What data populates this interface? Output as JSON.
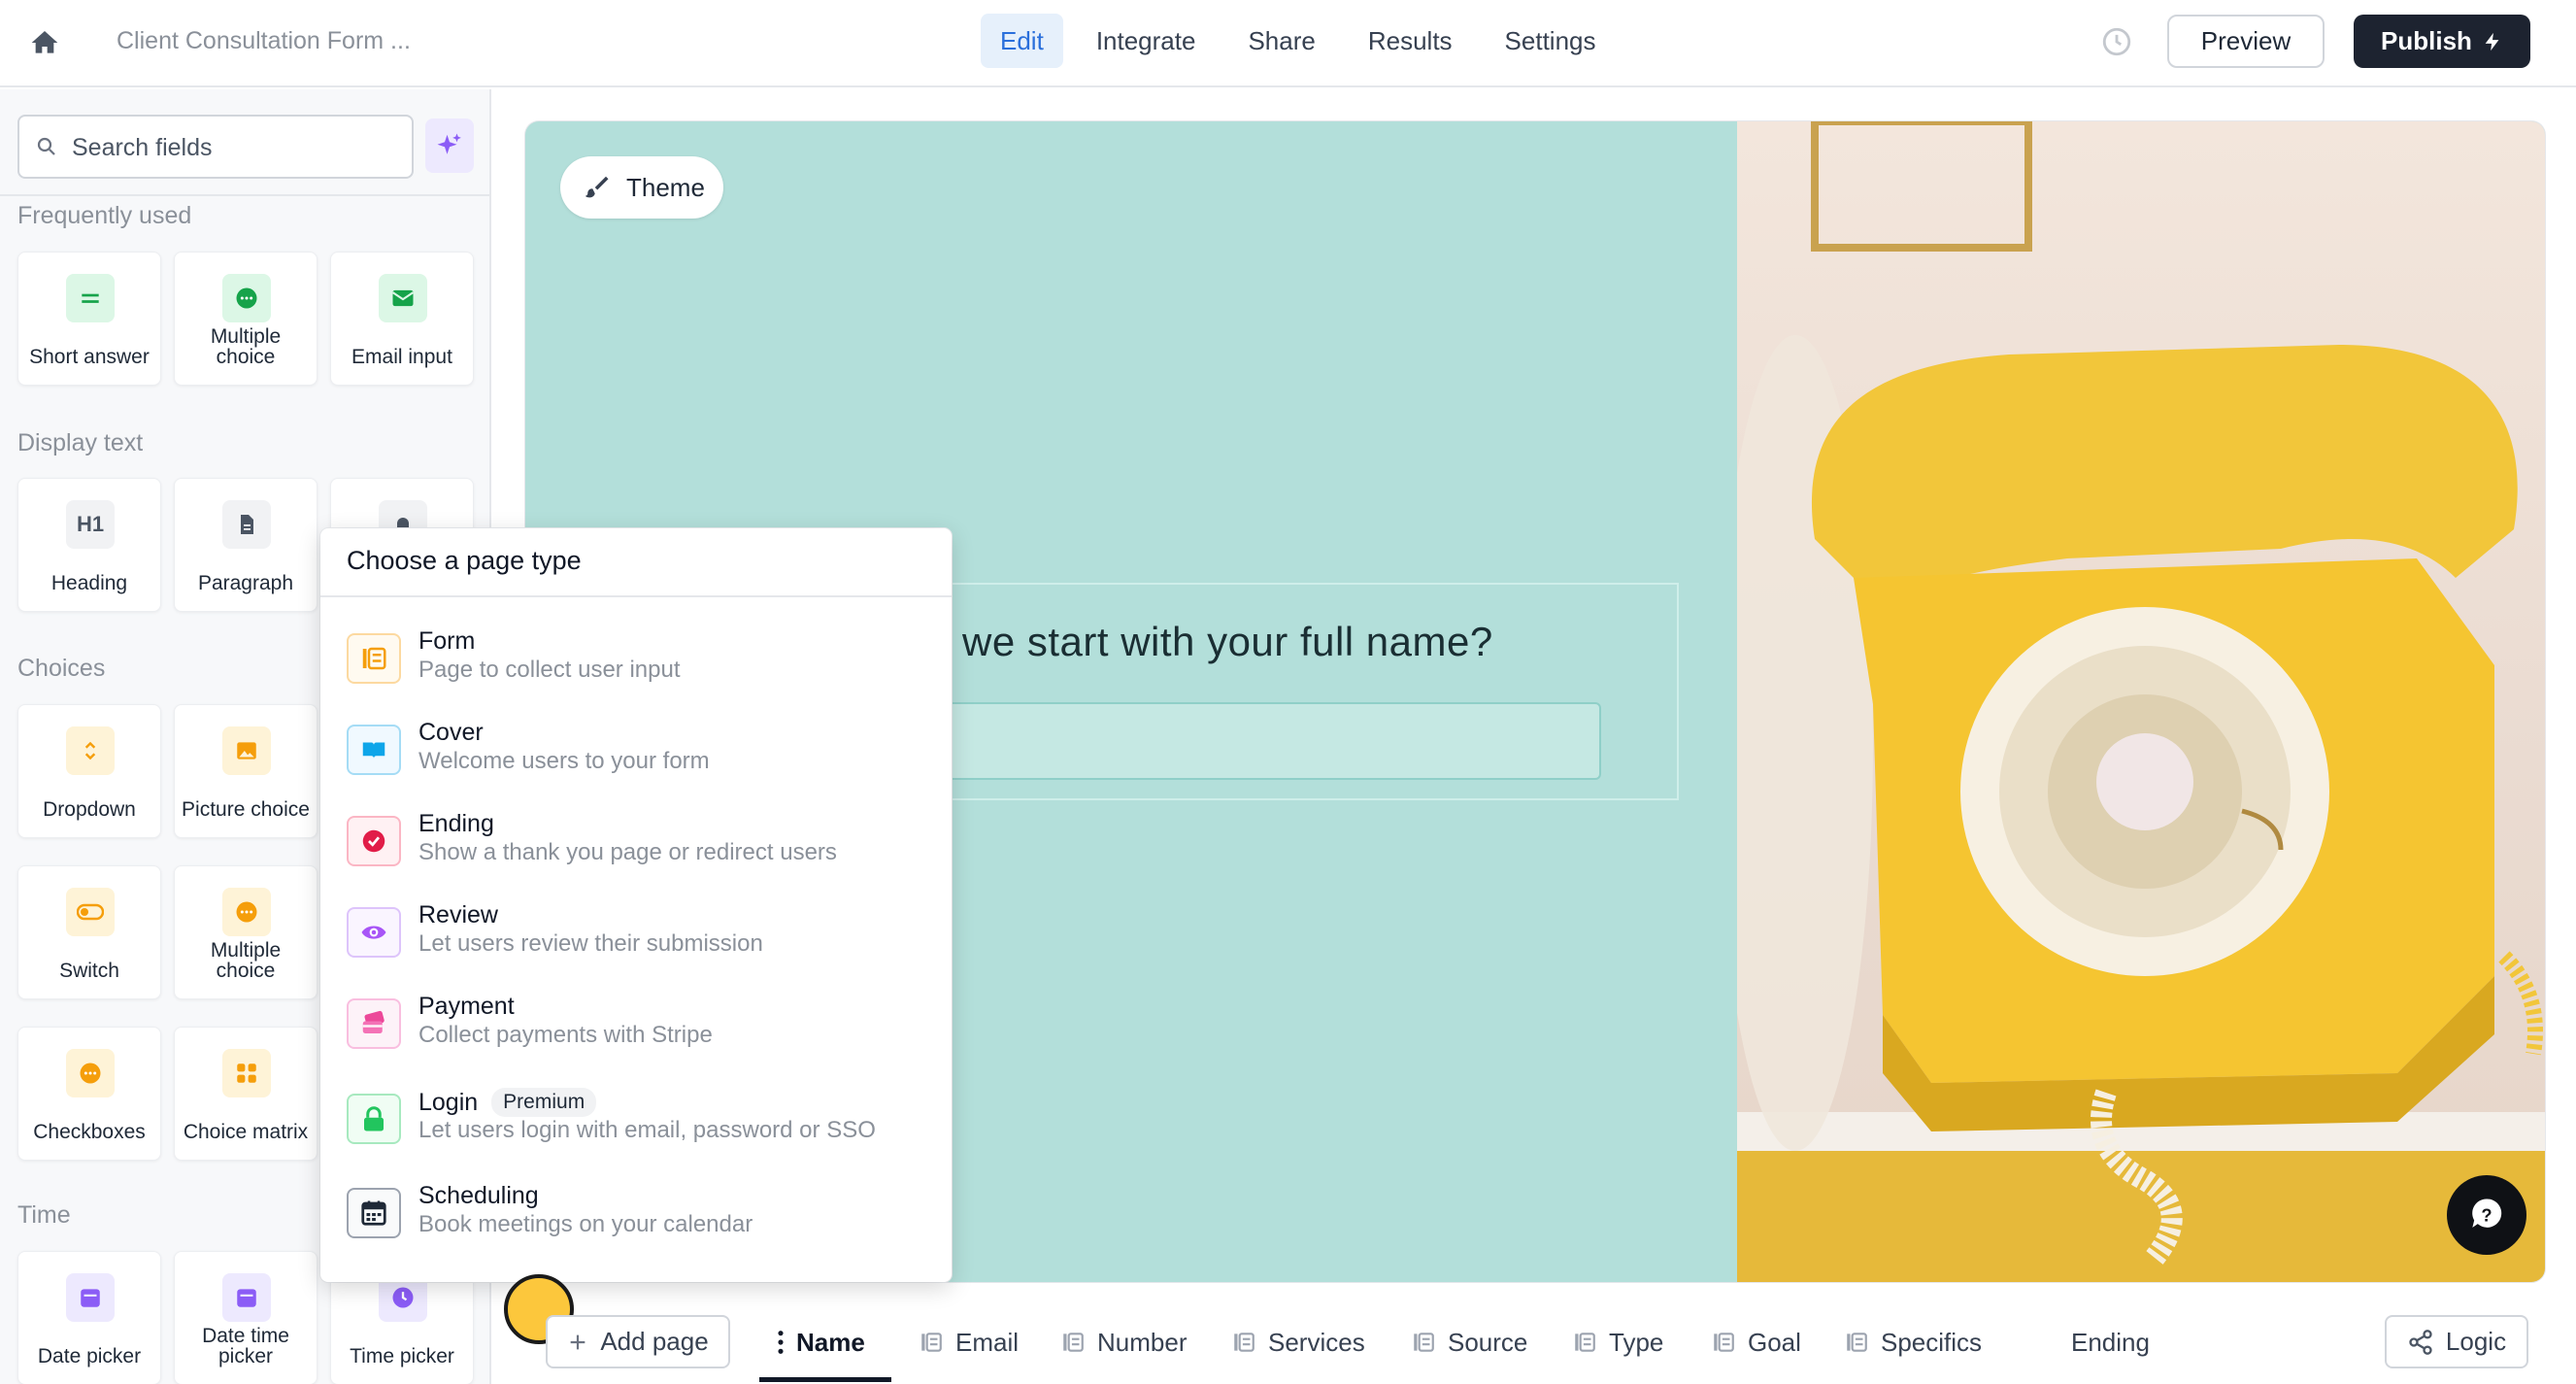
{
  "topbar": {
    "doc_title": "Client Consultation Form ...",
    "tabs": [
      {
        "label": "Edit",
        "active": true
      },
      {
        "label": "Integrate"
      },
      {
        "label": "Share"
      },
      {
        "label": "Results"
      },
      {
        "label": "Settings"
      }
    ],
    "preview_label": "Preview",
    "publish_label": "Publish"
  },
  "sidebar": {
    "search_placeholder": "Search fields",
    "sections": {
      "frequently_used": "Frequently used",
      "display_text": "Display text",
      "choices": "Choices",
      "time": "Time"
    },
    "fields": {
      "short_answer": "Short answer",
      "multiple_choice": "Multiple choice",
      "email_input": "Email input",
      "heading": "Heading",
      "heading_icon_text": "H1",
      "paragraph": "Paragraph",
      "dropdown": "Dropdown",
      "picture_choice": "Picture choice",
      "switch": "Switch",
      "multiple_choice_2": "Multiple choice",
      "checkboxes": "Checkboxes",
      "choice_matrix": "Choice matrix",
      "date_picker": "Date picker",
      "date_time_picker": "Date time picker",
      "time_picker": "Time picker"
    }
  },
  "canvas": {
    "theme_label": "Theme",
    "question_text": "we start with your full name?"
  },
  "popover": {
    "title": "Choose a page type",
    "types": [
      {
        "name": "Form",
        "desc": "Page to collect user input",
        "color": "#f59e0b",
        "icon": "form-icon"
      },
      {
        "name": "Cover",
        "desc": "Welcome users to your form",
        "color": "#0ea5e9",
        "icon": "book-icon"
      },
      {
        "name": "Ending",
        "desc": "Show a thank you page or redirect users",
        "color": "#e11d48",
        "icon": "check-circle-icon"
      },
      {
        "name": "Review",
        "desc": "Let users review their submission",
        "color": "#a855f7",
        "icon": "eye-icon"
      },
      {
        "name": "Payment",
        "desc": "Collect payments with Stripe",
        "color": "#ec4899",
        "icon": "payment-icon"
      },
      {
        "name": "Login",
        "badge": "Premium",
        "desc": "Let users login with email, password or SSO",
        "color": "#22c55e",
        "icon": "lock-icon"
      },
      {
        "name": "Scheduling",
        "desc": "Book meetings on your calendar",
        "color": "#1f2937",
        "icon": "calendar-icon"
      }
    ]
  },
  "bottombar": {
    "add_page_label": "Add page",
    "pages": [
      "Name",
      "Email",
      "Number",
      "Services",
      "Source",
      "Type",
      "Goal",
      "Specifics",
      "Ending"
    ],
    "active_page": "Name",
    "logic_label": "Logic"
  },
  "colors": {
    "canvas_bg": "#b3dfda",
    "accent": "#2a6fdb",
    "publish_bg": "#1d2330",
    "cursor_dot": "#fcc73c"
  }
}
